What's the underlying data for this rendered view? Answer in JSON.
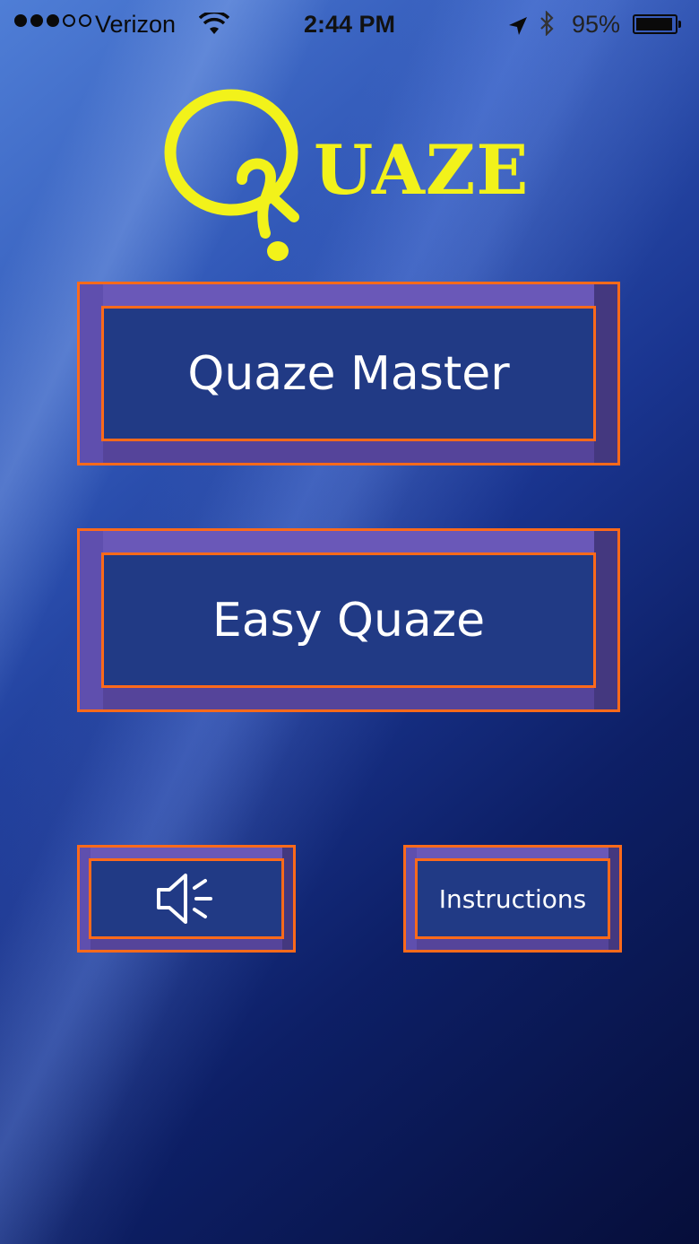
{
  "status_bar": {
    "carrier": "Verizon",
    "time": "2:44 PM",
    "battery": "95%",
    "battery_level": 0.95,
    "signal_bars_filled": 3,
    "signal_bars_total": 5
  },
  "logo": {
    "letter": "Q",
    "rest": "UAZE",
    "color": "#f2f21a"
  },
  "menu": {
    "quaze_master_label": "Quaze Master",
    "easy_quaze_label": "Easy Quaze",
    "sound_icon": "speaker-icon",
    "instructions_label": "Instructions"
  },
  "colors": {
    "button_border": "#ff6a1a",
    "button_face": "#213a85",
    "button_bevel": "#6a58b8"
  }
}
